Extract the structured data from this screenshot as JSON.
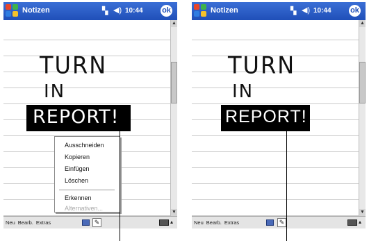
{
  "screens": [
    {
      "title": "Notizen",
      "clock": "10:44",
      "ok": "ok",
      "handwriting": {
        "line1": "TURN",
        "line2": "IN",
        "line3": "REPORT!"
      },
      "context_menu": [
        "Ausschneiden",
        "Kopieren",
        "Einfügen",
        "Löschen",
        "Erkennen",
        "Alternativen..."
      ],
      "toolbar": {
        "items": [
          "Neu",
          "Bearb.",
          "Extras"
        ]
      }
    },
    {
      "title": "Notizen",
      "clock": "10:44",
      "ok": "ok",
      "handwriting": {
        "line1": "TURN",
        "line2": "IN",
        "line3": "REPORT!"
      },
      "toolbar": {
        "items": [
          "Neu",
          "Bearb.",
          "Extras"
        ]
      }
    }
  ],
  "icons": {
    "start": "windows-flag-icon",
    "signal": "signal-icon",
    "volume": "speaker-icon",
    "keyboard": "keyboard-icon",
    "pen": "pen-icon",
    "sip": "input-panel-icon"
  },
  "colors": {
    "titlebar": "#2458c6",
    "selection": "#000000",
    "toolbar": "#e4e4e4"
  }
}
